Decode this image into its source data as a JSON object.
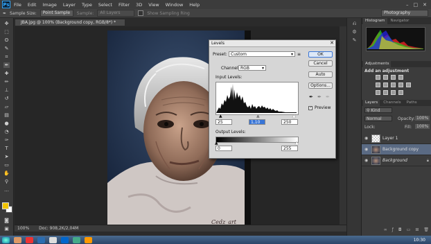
{
  "app": {
    "logo": "Ps"
  },
  "menu": [
    "File",
    "Edit",
    "Image",
    "Layer",
    "Type",
    "Select",
    "Filter",
    "3D",
    "View",
    "Window",
    "Help"
  ],
  "window_controls": [
    "–",
    "□",
    "✕"
  ],
  "options": {
    "sample_size_label": "Sample Size:",
    "sample_size_value": "Point Sample",
    "sample_label": "Sample:",
    "sample_value": "All Layers",
    "show_ring_label": "Show Sampling Ring",
    "workspace": "Photography"
  },
  "document": {
    "tab_title": "JBA.jpg @ 100% (Background copy, RGB/8*) *",
    "zoom": "100%",
    "doc_size": "Doc: 908,2K/2,04M",
    "watermark": "Cedz_art"
  },
  "levels": {
    "title": "Levels",
    "preset_label": "Preset:",
    "preset_value": "Custom",
    "channel_label": "Channel:",
    "channel_value": "RGB",
    "input_levels_label": "Input Levels:",
    "input_black": "25",
    "input_gamma": "1,10",
    "input_white": "250",
    "output_levels_label": "Output Levels:",
    "output_black": "0",
    "output_white": "255",
    "ok": "OK",
    "cancel": "Cancel",
    "auto": "Auto",
    "options": "Options...",
    "preview": "Preview",
    "preview_checked": true
  },
  "panels": {
    "tabs_top": [
      "Histogram",
      "Navigator"
    ],
    "adjustments_tab": "Adjustments",
    "add_adjustment": "Add an adjustment",
    "layers_tabs": [
      "Layers",
      "Channels",
      "Paths"
    ],
    "kind_label": "Kind",
    "blend_mode": "Normal",
    "opacity_label": "Opacity:",
    "opacity_value": "100%",
    "lock_label": "Lock:",
    "fill_label": "Fill:",
    "fill_value": "100%",
    "layers": [
      {
        "name": "Layer 1",
        "selected": false
      },
      {
        "name": "Background copy",
        "selected": true
      },
      {
        "name": "Background",
        "selected": false
      }
    ]
  },
  "taskbar": {
    "clock": "10:30"
  },
  "colors": {
    "foreground": "#f2c400",
    "background": "#ffffff",
    "accent": "#31a8ff"
  }
}
